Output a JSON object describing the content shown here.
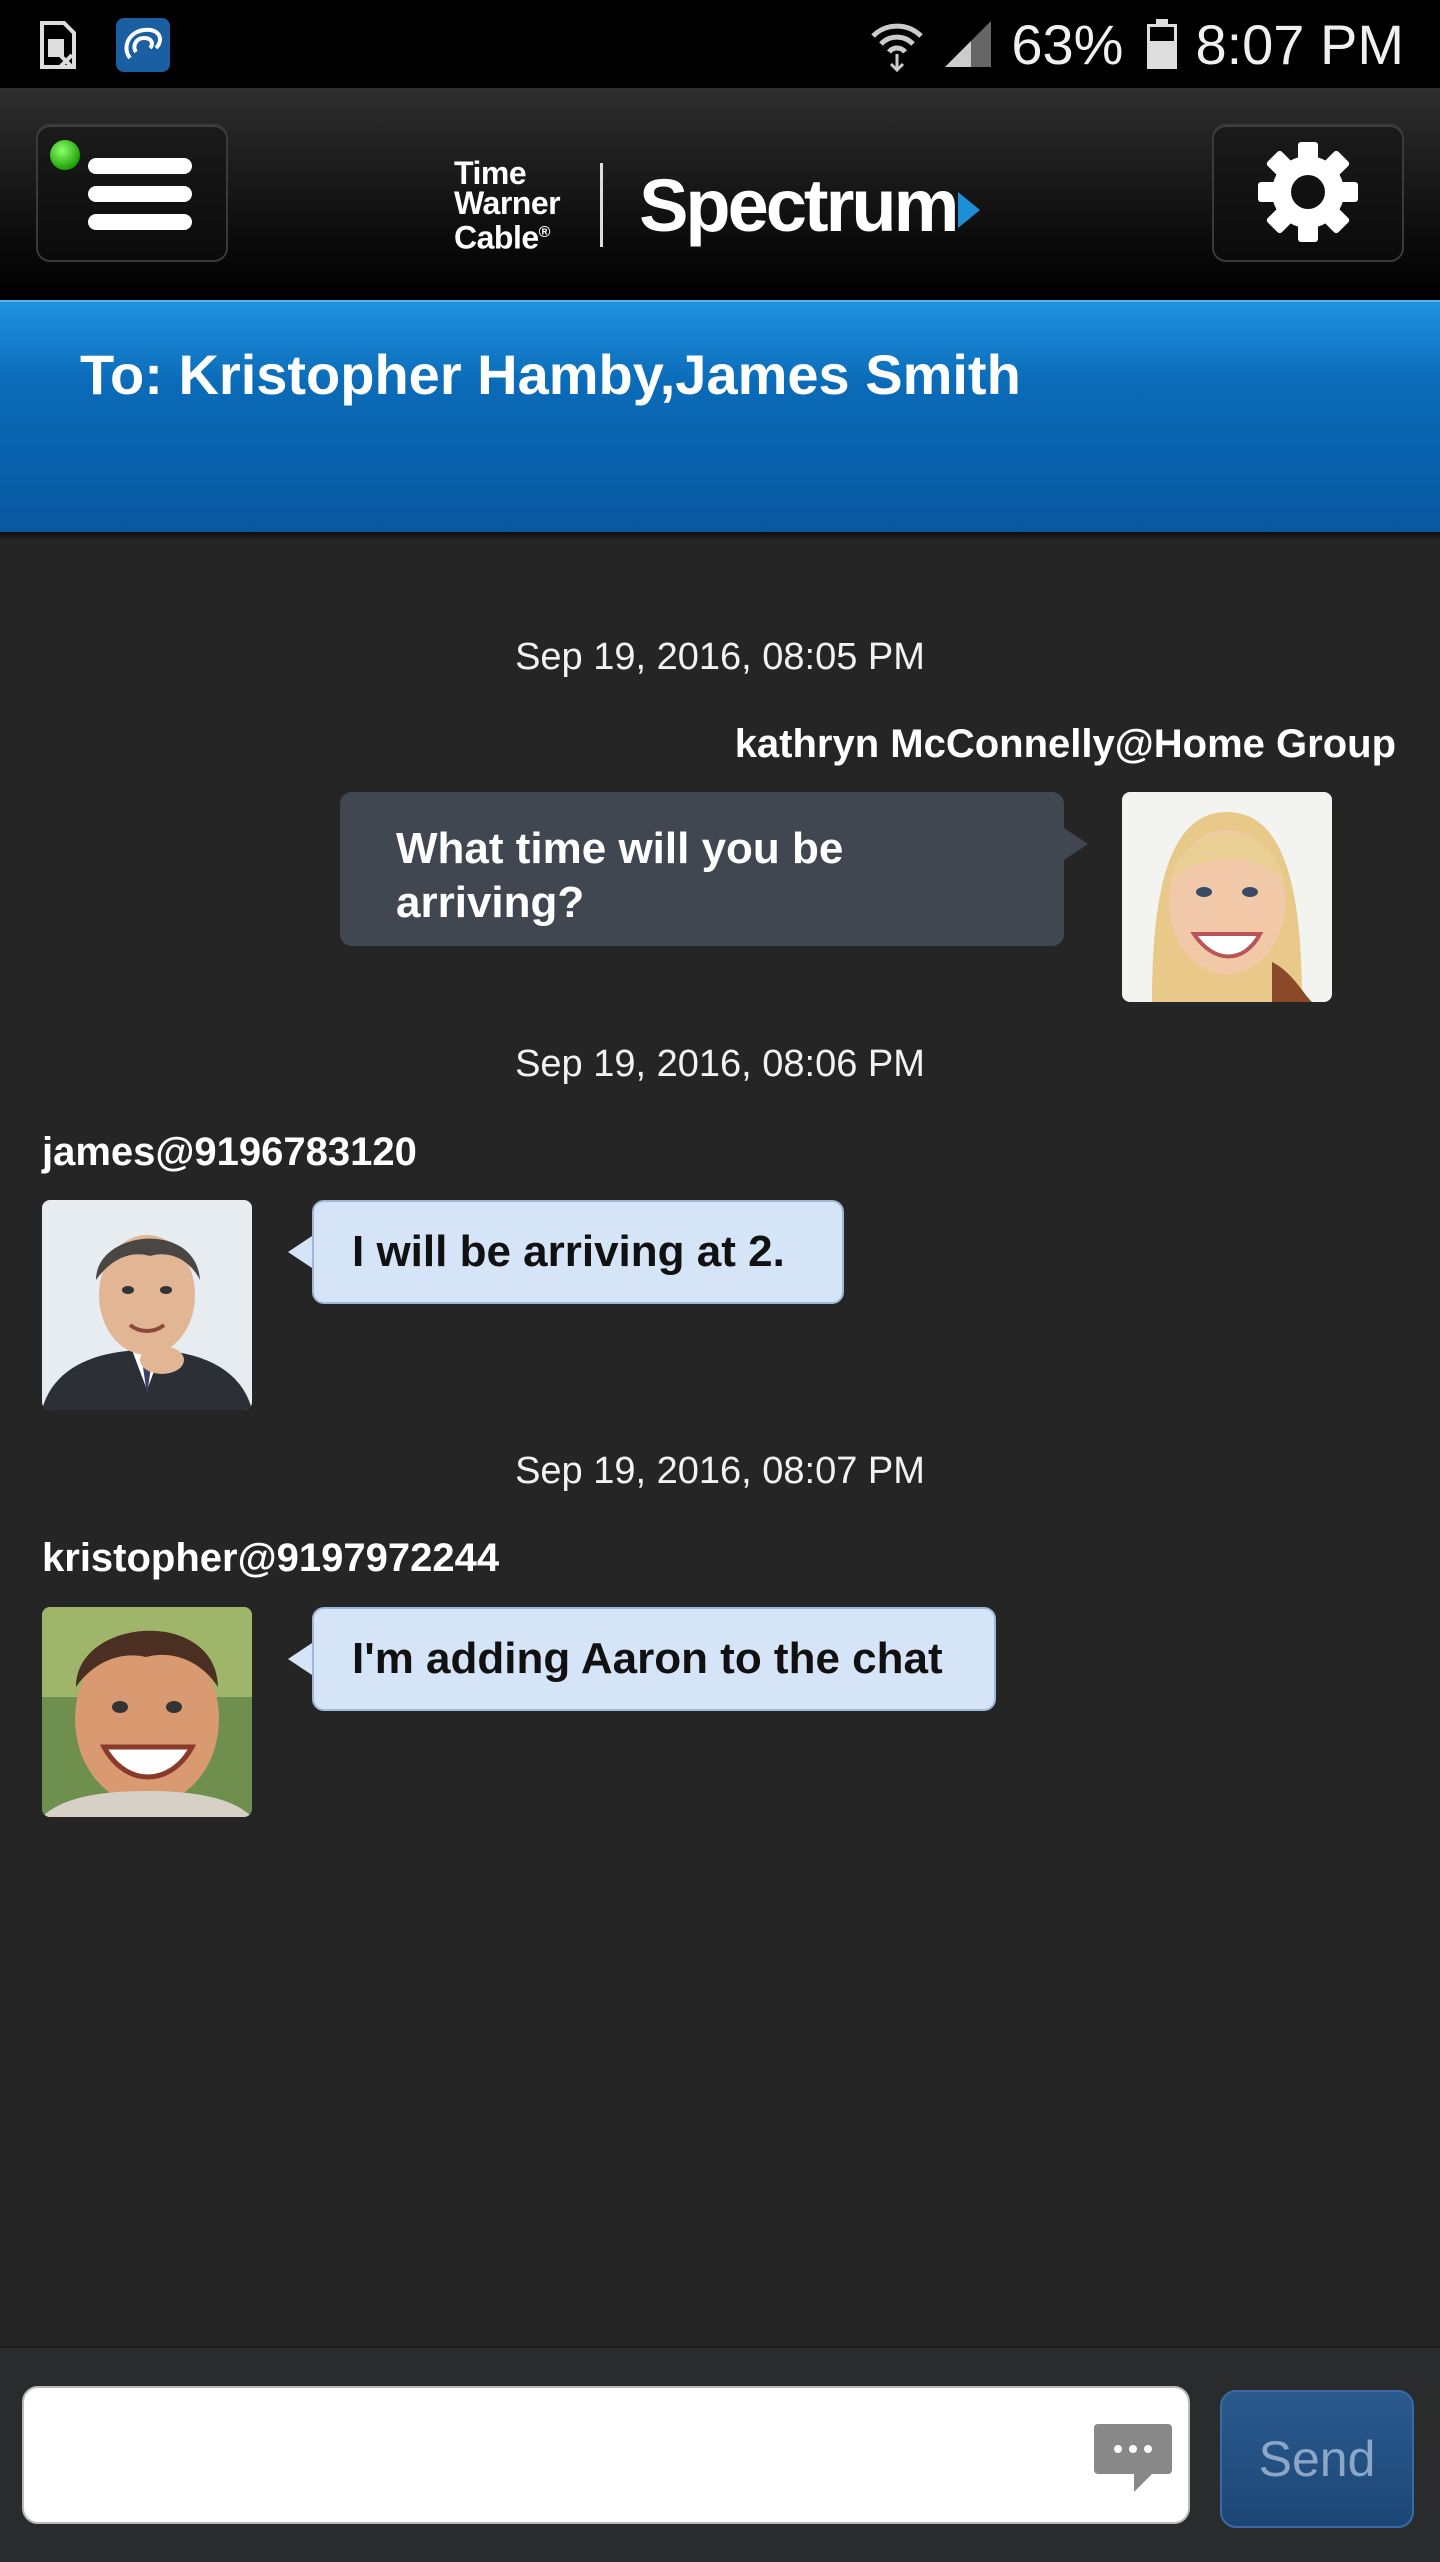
{
  "status_bar": {
    "battery_percent": "63%",
    "time": "8:07 PM",
    "icons": [
      "sim-card-icon",
      "twc-app-icon",
      "wifi-icon",
      "signal-icon",
      "battery-icon"
    ]
  },
  "header": {
    "logo_twc_lines": [
      "Time",
      "Warner",
      "Cable"
    ],
    "logo_twc_mark": "®",
    "logo_spectrum": "Spectrum",
    "brand_color": "#1d8fd6",
    "icons": [
      "menu-icon",
      "gear-icon"
    ]
  },
  "recipients": {
    "text": "To: Kristopher Hamby,James Smith"
  },
  "messages": [
    {
      "timestamp": "Sep 19, 2016, 08:05 PM",
      "sender": "kathryn McConnelly@Home Group",
      "text": "What time will you be arriving?",
      "direction": "outgoing"
    },
    {
      "timestamp": "Sep 19, 2016, 08:06 PM",
      "sender": "james@9196783120",
      "text": "I will be arriving at 2.",
      "direction": "incoming"
    },
    {
      "timestamp": "Sep 19, 2016, 08:07 PM",
      "sender": "kristopher@9197972244",
      "text": "I'm adding Aaron to the chat",
      "direction": "incoming"
    }
  ],
  "composer": {
    "input_value": "",
    "send_label": "Send"
  },
  "colors": {
    "background": "#252526",
    "header_blue": "#0b6bb8",
    "outgoing_bubble": "#414750",
    "incoming_bubble": "#d5e4f7"
  }
}
